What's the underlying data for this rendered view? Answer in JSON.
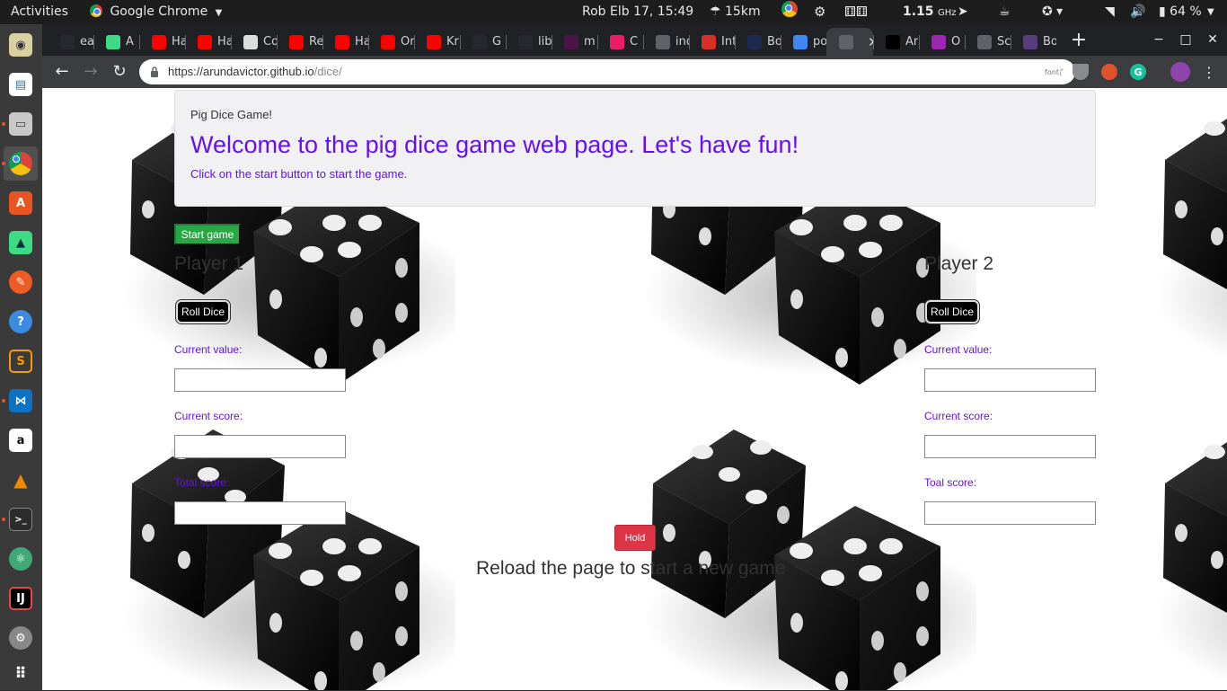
{
  "system_bar": {
    "activities": "Activities",
    "app_name": "Google Chrome",
    "datetime": "Rob Elb 17, 15:49",
    "weather": "15km",
    "cpu": "1.15",
    "cpu_unit": "GHz",
    "battery": "64 %"
  },
  "browser": {
    "tabs": [
      {
        "label": "ea",
        "icon": "github-icon",
        "color": "#24292e"
      },
      {
        "label": "A",
        "icon": "android-icon",
        "color": "#3ddc84"
      },
      {
        "label": "Ha",
        "icon": "youtube-icon",
        "color": "#ff0000"
      },
      {
        "label": "Ha",
        "icon": "youtube-icon",
        "color": "#ff0000"
      },
      {
        "label": "Co",
        "icon": "doc-icon",
        "color": "#dddddd"
      },
      {
        "label": "Re",
        "icon": "youtube-icon",
        "color": "#ff0000"
      },
      {
        "label": "Ha",
        "icon": "youtube-icon",
        "color": "#ff0000"
      },
      {
        "label": "Or",
        "icon": "youtube-icon",
        "color": "#ff0000"
      },
      {
        "label": "Kr",
        "icon": "youtube-icon",
        "color": "#ff0000"
      },
      {
        "label": "G",
        "icon": "github-icon",
        "color": "#24292e"
      },
      {
        "label": "lib",
        "icon": "github-icon",
        "color": "#24292e"
      },
      {
        "label": "m",
        "icon": "slack-icon",
        "color": "#4a154b"
      },
      {
        "label": "C",
        "icon": "cast-icon",
        "color": "#e91e63"
      },
      {
        "label": "ind",
        "icon": "page-icon",
        "color": "#5f6368"
      },
      {
        "label": "Int",
        "icon": "gmail-icon",
        "color": "#d93025"
      },
      {
        "label": "Bo",
        "icon": "mdn-icon",
        "color": "#1b2a4e"
      },
      {
        "label": "po",
        "icon": "google-icon",
        "color": "#4285f4"
      },
      {
        "label": "",
        "icon": "page-icon",
        "color": "#5f6368",
        "active": true
      },
      {
        "label": "Ar",
        "icon": "medium-icon",
        "color": "#000000"
      },
      {
        "label": "O",
        "icon": "colorful-icon",
        "color": "#9c27b0"
      },
      {
        "label": "Sc",
        "icon": "page-icon",
        "color": "#5f6368"
      },
      {
        "label": "Bo",
        "icon": "bootstrap-icon",
        "color": "#563d7c"
      }
    ],
    "url_host": "https://arundavictor.github.io",
    "url_path": "/dice/",
    "ext_font_label": "font"
  },
  "page": {
    "jumbotron_top": "Pig Dice Game!",
    "jumbotron_title": "Welcome to the pig dice game web page. Let's have fun!",
    "jumbotron_sub": "Click on the start button to start the game.",
    "start_button": "Start game",
    "player1": {
      "title": "Player 1",
      "roll": "Roll Dice",
      "current_value_label": "Current value:",
      "current_score_label": "Current score:",
      "total_score_label": "Total score:"
    },
    "player2": {
      "title": "Player 2",
      "roll": "Roll Dice",
      "current_value_label": "Current value:",
      "current_score_label": "Current score:",
      "total_score_label": "Toal score:"
    },
    "hold_button": "Hold",
    "reload_text": "Reload the page to start a new game"
  }
}
